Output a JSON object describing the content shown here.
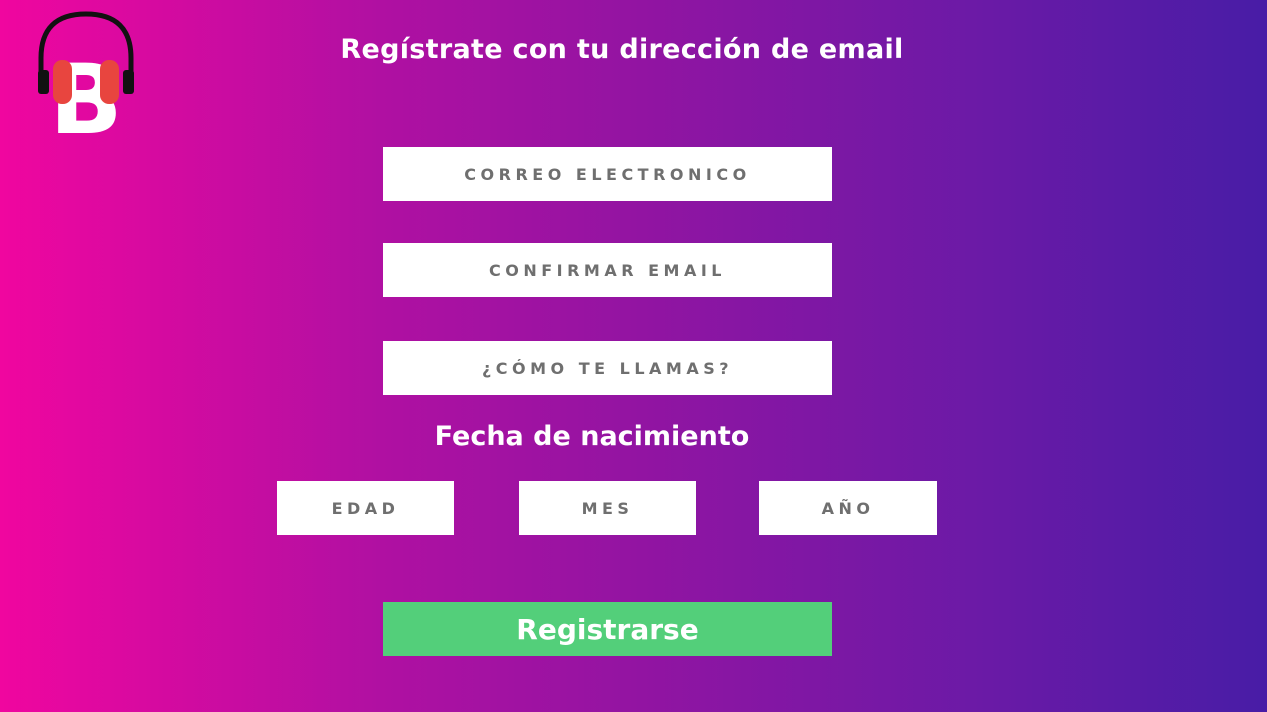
{
  "header": {
    "logo_icon": "headphones-b-logo",
    "title": "Regístrate con tu dirección de email"
  },
  "form": {
    "email_placeholder": "CORREO ELECTRONICO",
    "confirm_email_placeholder": "CONFIRMAR EMAIL",
    "name_placeholder": "¿CÓMO TE LLAMAS?",
    "birthdate_label": "Fecha de nacimiento",
    "day_placeholder": "EDAD",
    "month_placeholder": "MES",
    "year_placeholder": "AÑO",
    "submit_label": "Registrarse"
  },
  "colors": {
    "gradient_start": "#f0069f",
    "gradient_end": "#481ca6",
    "submit_button": "#53cf7a",
    "logo_letter": "#ffffff",
    "logo_earcups": "#e8453f",
    "logo_headband": "#111111"
  }
}
